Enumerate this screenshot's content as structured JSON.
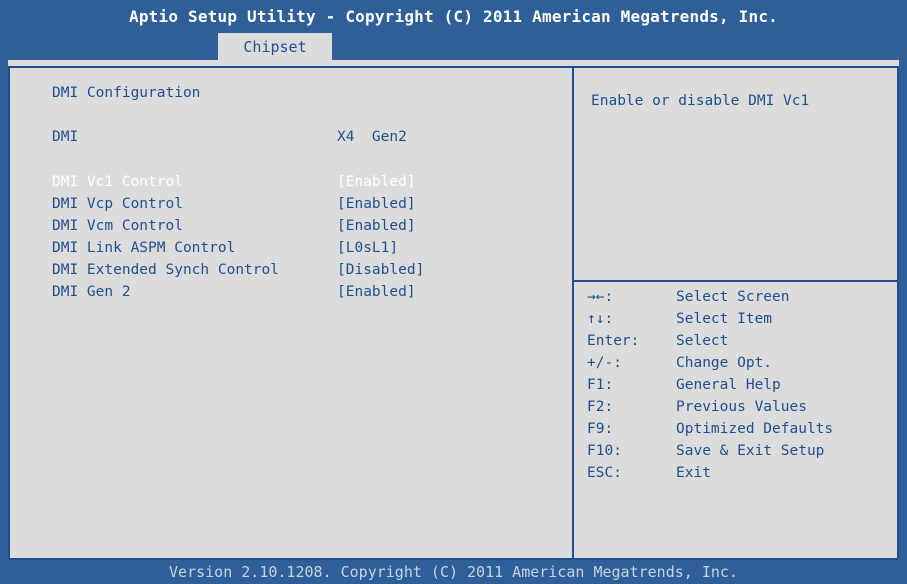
{
  "header": {
    "title": "Aptio Setup Utility - Copyright (C) 2011 American Megatrends, Inc.",
    "tab": "Chipset"
  },
  "main": {
    "section_title": "DMI Configuration",
    "dmi_label": "DMI",
    "dmi_value": "X4  Gen2",
    "options": [
      {
        "label": "DMI Vc1 Control",
        "value": "[Enabled]"
      },
      {
        "label": "DMI Vcp Control",
        "value": "[Enabled]"
      },
      {
        "label": "DMI Vcm Control",
        "value": "[Enabled]"
      },
      {
        "label": "DMI Link ASPM Control",
        "value": "[L0sL1]"
      },
      {
        "label": "DMI Extended Synch Control",
        "value": "[Disabled]"
      },
      {
        "label": "DMI Gen 2",
        "value": "[Enabled]"
      }
    ]
  },
  "help": {
    "text": "Enable or disable DMI Vc1"
  },
  "keys": [
    {
      "key": "→←:",
      "desc": "Select Screen"
    },
    {
      "key": "↑↓:",
      "desc": "Select Item"
    },
    {
      "key": "Enter:",
      "desc": "Select"
    },
    {
      "key": "+/-:",
      "desc": "Change Opt."
    },
    {
      "key": "F1:",
      "desc": "General Help"
    },
    {
      "key": "F2:",
      "desc": "Previous Values"
    },
    {
      "key": "F9:",
      "desc": "Optimized Defaults"
    },
    {
      "key": "F10:",
      "desc": "Save & Exit Setup"
    },
    {
      "key": "ESC:",
      "desc": "Exit"
    }
  ],
  "footer": {
    "text": "Version 2.10.1208. Copyright (C) 2011 American Megatrends, Inc."
  },
  "colors": {
    "accent": "#2f5f99",
    "text": "#1d4f8e",
    "panel": "#dcdcdc",
    "selected": "#ffffff"
  }
}
